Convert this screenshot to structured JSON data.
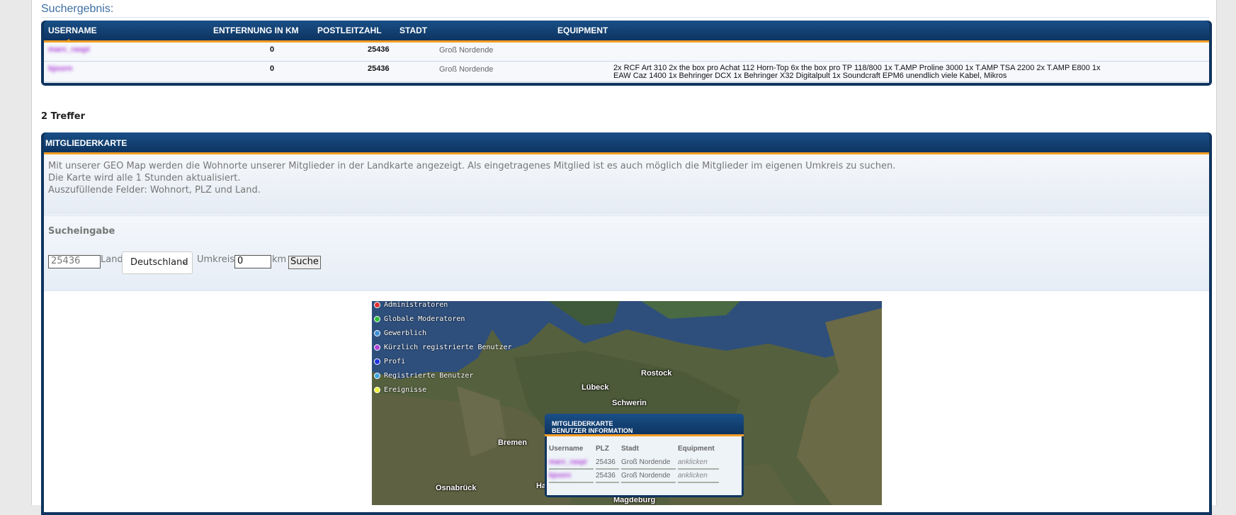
{
  "search_result": {
    "title": "Suchergebnis:",
    "columns": [
      "USERNAME",
      "ENTFERNUNG IN KM",
      "POSTLEITZAHL",
      "STADT",
      "EQUIPMENT"
    ],
    "rows": [
      {
        "username": "marc_raspi",
        "distance": "0",
        "plz": "25436",
        "city": "Groß Nordende",
        "equipment": ""
      },
      {
        "username": "bjoorn",
        "distance": "0",
        "plz": "25436",
        "city": "Groß Nordende",
        "equipment": "2x RCF Art 310 2x the box pro Achat 112 Horn-Top 6x the box pro TP 118/800 1x T.AMP Proline 3000 1x T.AMP TSA 2200 2x T.AMP E800 1x EAW Caz 1400 1x Behringer DCX 1x Behringer X32 Digitalpult 1x Soundcraft EPM6 unendlich viele Kabel, Mikros"
      }
    ],
    "hits": "2 Treffer"
  },
  "member_map": {
    "title": "MITGLIEDERKARTE",
    "description": [
      "Mit unserer GEO Map werden die Wohnorte unserer Mitglieder in der Landkarte angezeigt. Als eingetragenes Mitglied ist es auch möglich die Mitglieder im eigenen Umkreis zu suchen.",
      "Die Karte wird alle 1 Stunden aktualisiert.",
      "Auszufüllende Felder: Wohnort, PLZ und Land."
    ],
    "search": {
      "label": "Sucheingabe",
      "plz_value": "25436",
      "land_label": "Land",
      "land_value": "Deutschland",
      "radius_label": "Umkreis",
      "radius_value": "0",
      "unit": "km",
      "button": "Suche"
    },
    "legend": [
      {
        "label": "Administratoren",
        "color": "#e03030"
      },
      {
        "label": "Globale Moderatoren",
        "color": "#2fbf3a"
      },
      {
        "label": "Gewerblich",
        "color": "#3b8fd8"
      },
      {
        "label": "Kürzlich registrierte Benutzer",
        "color": "#b040d8"
      },
      {
        "label": "Profi",
        "color": "#2233dd"
      },
      {
        "label": "Registrierte Benutzer",
        "color": "#3fa6e0"
      },
      {
        "label": "Ereignisse",
        "color": "#f0f040"
      }
    ],
    "cities": [
      "Rostock",
      "Lübeck",
      "Schwerin",
      "Bremen",
      "Osnabrück",
      "Ha",
      "Magdeburg"
    ],
    "popup": {
      "title_line1": "MITGLIEDERKARTE",
      "title_line2": "BENUTZER INFORMATION",
      "headers": [
        "Username",
        "PLZ",
        "Stadt",
        "Equipment"
      ],
      "rows": [
        {
          "username": "marc_raspi",
          "plz": "25436",
          "city": "Groß Nordende",
          "equipment": "anklicken"
        },
        {
          "username": "bjoorn",
          "plz": "25436",
          "city": "Groß Nordende",
          "equipment": "anklicken"
        }
      ]
    }
  }
}
